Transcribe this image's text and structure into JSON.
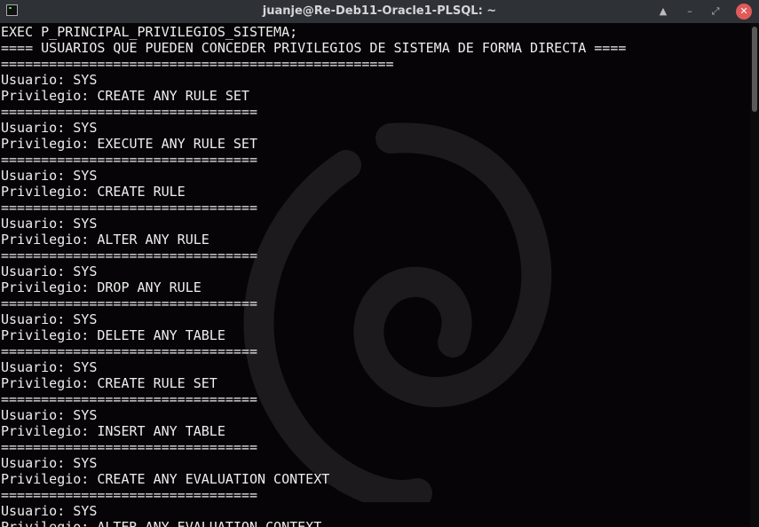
{
  "window": {
    "title": "juanje@Re-Deb11-Oracle1-PLSQL: ~",
    "buttons": {
      "keep_above": "▲",
      "minimize": "–",
      "maximize": "⤢",
      "close": "✕"
    }
  },
  "terminal": {
    "lines": [
      "EXEC P_PRINCIPAL_PRIVILEGIOS_SISTEMA;",
      "==== USUARIOS QUE PUEDEN CONCEDER PRIVILEGIOS DE SISTEMA DE FORMA DIRECTA ====",
      "=================================================",
      "Usuario: SYS",
      "Privilegio: CREATE ANY RULE SET",
      "================================",
      "Usuario: SYS",
      "Privilegio: EXECUTE ANY RULE SET",
      "================================",
      "Usuario: SYS",
      "Privilegio: CREATE RULE",
      "================================",
      "Usuario: SYS",
      "Privilegio: ALTER ANY RULE",
      "================================",
      "Usuario: SYS",
      "Privilegio: DROP ANY RULE",
      "================================",
      "Usuario: SYS",
      "Privilegio: DELETE ANY TABLE",
      "================================",
      "Usuario: SYS",
      "Privilegio: CREATE RULE SET",
      "================================",
      "Usuario: SYS",
      "Privilegio: INSERT ANY TABLE",
      "================================",
      "Usuario: SYS",
      "Privilegio: CREATE ANY EVALUATION CONTEXT",
      "================================",
      "Usuario: SYS",
      "Privilegio: ALTER ANY EVALUATION CONTEXT"
    ]
  }
}
